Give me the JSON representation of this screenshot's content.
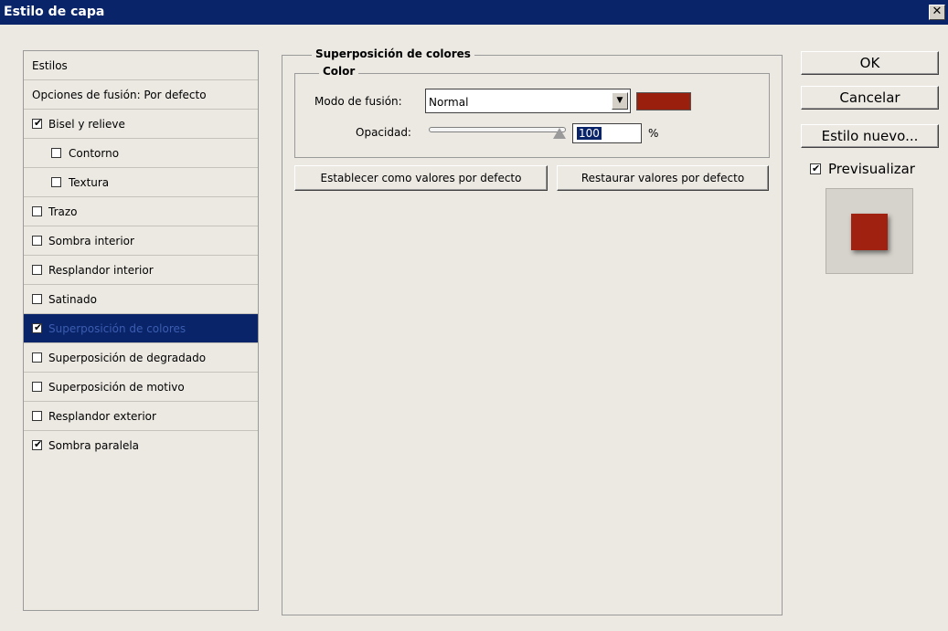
{
  "window": {
    "title": "Estilo de capa",
    "close_glyph": "✕"
  },
  "sidebar": {
    "header": "Estilos",
    "items": [
      {
        "label": "Opciones de fusión: Por defecto"
      },
      {
        "label": "Bisel y relieve",
        "checked": true
      },
      {
        "label": "Contorno",
        "checked": false,
        "indent": true
      },
      {
        "label": "Textura",
        "checked": false,
        "indent": true
      },
      {
        "label": "Trazo",
        "checked": false
      },
      {
        "label": "Sombra interior",
        "checked": false
      },
      {
        "label": "Resplandor interior",
        "checked": false
      },
      {
        "label": "Satinado",
        "checked": false
      },
      {
        "label": "Superposición de colores",
        "checked": true,
        "selected": true
      },
      {
        "label": "Superposición de degradado",
        "checked": false
      },
      {
        "label": "Superposición de motivo",
        "checked": false
      },
      {
        "label": "Resplandor exterior",
        "checked": false
      },
      {
        "label": "Sombra paralela",
        "checked": true
      }
    ]
  },
  "panel": {
    "title": "Superposición de colores",
    "group_title": "Color",
    "blend_label": "Modo de fusión:",
    "blend_value": "Normal",
    "overlay_color": "#9a1f0d",
    "opacity_label": "Opacidad:",
    "opacity_value": "100",
    "opacity_unit": "%",
    "set_default_button": "Establecer como valores por defecto",
    "reset_default_button": "Restaurar valores por defecto"
  },
  "actions": {
    "ok": "OK",
    "cancel": "Cancelar",
    "new_style": "Estilo nuevo...",
    "preview_label": "Previsualizar",
    "preview_checked": true
  }
}
